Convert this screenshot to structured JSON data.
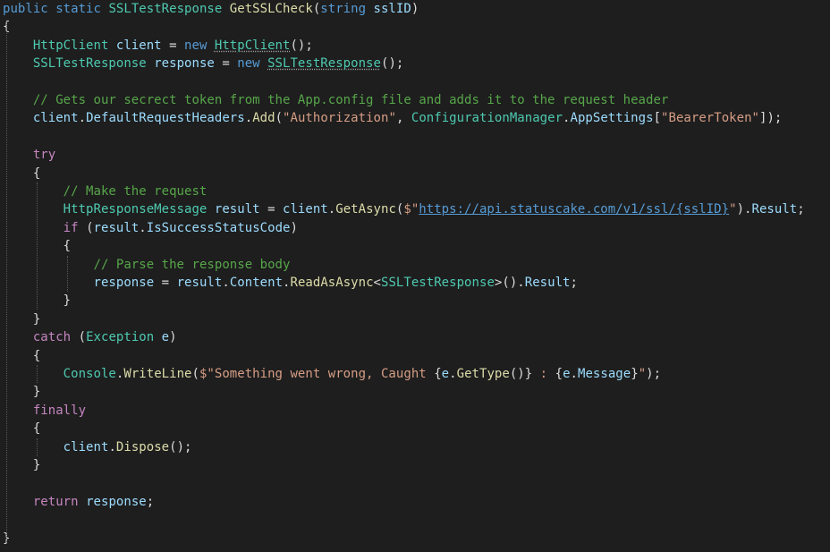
{
  "colors": {
    "background": "#1e1e1e",
    "keyword": "#569cd6",
    "control_keyword": "#c586c0",
    "type": "#4ec9b0",
    "method": "#dcdcaa",
    "identifier": "#9cdcfe",
    "string": "#d69d85",
    "comment": "#57a64a",
    "punctuation": "#dcdcdc"
  },
  "code_lines": [
    [
      [
        "kw",
        "public static "
      ],
      [
        "ty",
        "SSLTestResponse "
      ],
      [
        "fn",
        "GetSSLCheck"
      ],
      [
        "pl",
        "("
      ],
      [
        "kw",
        "string "
      ],
      [
        "vr",
        "sslID"
      ],
      [
        "pl",
        ")"
      ]
    ],
    [
      [
        "pl",
        "{"
      ]
    ],
    [
      [
        "pl",
        "    "
      ],
      [
        "ty",
        "HttpClient "
      ],
      [
        "vr",
        "client "
      ],
      [
        "pl",
        "= "
      ],
      [
        "kw",
        "new "
      ],
      [
        "ty",
        "HttpClient"
      ],
      [
        "pl",
        "();"
      ]
    ],
    [
      [
        "pl",
        "    "
      ],
      [
        "ty",
        "SSLTestResponse "
      ],
      [
        "vr",
        "response "
      ],
      [
        "pl",
        "= "
      ],
      [
        "kw",
        "new "
      ],
      [
        "ty",
        "SSLTestResponse"
      ],
      [
        "pl",
        "();"
      ]
    ],
    [],
    [
      [
        "pl",
        "    "
      ],
      [
        "cm",
        "// Gets our secrect token from the App.config file and adds it to the request header"
      ]
    ],
    [
      [
        "pl",
        "    "
      ],
      [
        "vr",
        "client"
      ],
      [
        "pl",
        "."
      ],
      [
        "vr",
        "DefaultRequestHeaders"
      ],
      [
        "pl",
        "."
      ],
      [
        "fn",
        "Add"
      ],
      [
        "pl",
        "("
      ],
      [
        "st",
        "\"Authorization\""
      ],
      [
        "pl",
        ", "
      ],
      [
        "ty",
        "ConfigurationManager"
      ],
      [
        "pl",
        "."
      ],
      [
        "vr",
        "AppSettings"
      ],
      [
        "pl",
        "["
      ],
      [
        "st",
        "\"BearerToken\""
      ],
      [
        "pl",
        "]);"
      ]
    ],
    [],
    [
      [
        "pl",
        "    "
      ],
      [
        "ct",
        "try"
      ]
    ],
    [
      [
        "pl",
        "    {"
      ]
    ],
    [
      [
        "pl",
        "        "
      ],
      [
        "cm",
        "// Make the request"
      ]
    ],
    [
      [
        "pl",
        "        "
      ],
      [
        "ty",
        "HttpResponseMessage "
      ],
      [
        "vr",
        "result "
      ],
      [
        "pl",
        "= "
      ],
      [
        "vr",
        "client"
      ],
      [
        "pl",
        "."
      ],
      [
        "fn",
        "GetAsync"
      ],
      [
        "pl",
        "("
      ],
      [
        "st",
        "$\""
      ],
      [
        "url",
        "https://api.statuscake.com/v1/ssl/{sslID}"
      ],
      [
        "st",
        "\""
      ],
      [
        "pl",
        ")."
      ],
      [
        "vr",
        "Result"
      ],
      [
        "pl",
        ";"
      ]
    ],
    [
      [
        "pl",
        "        "
      ],
      [
        "ct",
        "if "
      ],
      [
        "pl",
        "("
      ],
      [
        "vr",
        "result"
      ],
      [
        "pl",
        "."
      ],
      [
        "vr",
        "IsSuccessStatusCode"
      ],
      [
        "pl",
        ")"
      ]
    ],
    [
      [
        "pl",
        "        {"
      ]
    ],
    [
      [
        "pl",
        "            "
      ],
      [
        "cm",
        "// Parse the response body"
      ]
    ],
    [
      [
        "pl",
        "            "
      ],
      [
        "vr",
        "response "
      ],
      [
        "pl",
        "= "
      ],
      [
        "vr",
        "result"
      ],
      [
        "pl",
        "."
      ],
      [
        "vr",
        "Content"
      ],
      [
        "pl",
        "."
      ],
      [
        "fn",
        "ReadAsAsync"
      ],
      [
        "pl",
        "<"
      ],
      [
        "ty",
        "SSLTestResponse"
      ],
      [
        "pl",
        ">()."
      ],
      [
        "vr",
        "Result"
      ],
      [
        "pl",
        ";"
      ]
    ],
    [
      [
        "pl",
        "        }"
      ]
    ],
    [
      [
        "pl",
        "    }"
      ]
    ],
    [
      [
        "pl",
        "    "
      ],
      [
        "ct",
        "catch "
      ],
      [
        "pl",
        "("
      ],
      [
        "ty",
        "Exception "
      ],
      [
        "vr",
        "e"
      ],
      [
        "pl",
        ")"
      ]
    ],
    [
      [
        "pl",
        "    {"
      ]
    ],
    [
      [
        "pl",
        "        "
      ],
      [
        "ty",
        "Console"
      ],
      [
        "pl",
        "."
      ],
      [
        "fn",
        "WriteLine"
      ],
      [
        "pl",
        "("
      ],
      [
        "st",
        "$\"Something went wrong, Caught "
      ],
      [
        "pl",
        "{"
      ],
      [
        "vr",
        "e"
      ],
      [
        "pl",
        "."
      ],
      [
        "fn",
        "GetType"
      ],
      [
        "pl",
        "()}"
      ],
      [
        "st",
        " : "
      ],
      [
        "pl",
        "{"
      ],
      [
        "vr",
        "e"
      ],
      [
        "pl",
        "."
      ],
      [
        "vr",
        "Message"
      ],
      [
        "pl",
        "}"
      ],
      [
        "st",
        "\""
      ],
      [
        "pl",
        ");"
      ]
    ],
    [
      [
        "pl",
        "    }"
      ]
    ],
    [
      [
        "pl",
        "    "
      ],
      [
        "ct",
        "finally"
      ]
    ],
    [
      [
        "pl",
        "    {"
      ]
    ],
    [
      [
        "pl",
        "        "
      ],
      [
        "vr",
        "client"
      ],
      [
        "pl",
        "."
      ],
      [
        "fn",
        "Dispose"
      ],
      [
        "pl",
        "();"
      ]
    ],
    [
      [
        "pl",
        "    }"
      ]
    ],
    [],
    [
      [
        "pl",
        "    "
      ],
      [
        "ct",
        "return "
      ],
      [
        "vr",
        "response"
      ],
      [
        "pl",
        ";"
      ]
    ],
    [],
    [
      [
        "pl",
        "}"
      ]
    ]
  ]
}
